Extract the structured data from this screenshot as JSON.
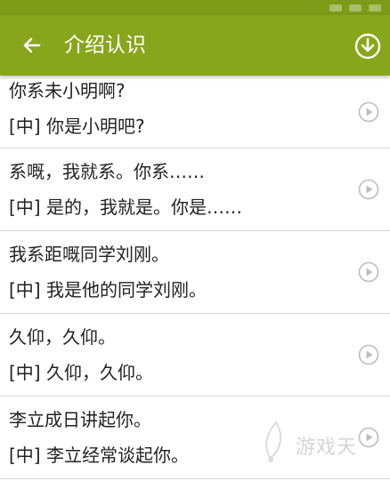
{
  "appbar": {
    "title": "介绍认识",
    "back_icon": "arrow-left-icon",
    "download_icon": "download-circle-icon",
    "color": "#88a61c"
  },
  "phrases": [
    {
      "cantonese": "你系未小明啊?",
      "mandarin": "[中] 你是小明吧?"
    },
    {
      "cantonese": "系嘅，我就系。你系……",
      "mandarin": "[中] 是的，我就是。你是……"
    },
    {
      "cantonese": "我系距嘅同学刘刚。",
      "mandarin": "[中] 我是他的同学刘刚。"
    },
    {
      "cantonese": "久仰，久仰。",
      "mandarin": "[中] 久仰，久仰。"
    },
    {
      "cantonese": "李立成日讲起你。",
      "mandarin": "[中] 李立经常谈起你。"
    }
  ],
  "watermark": {
    "text": "游戏天"
  }
}
